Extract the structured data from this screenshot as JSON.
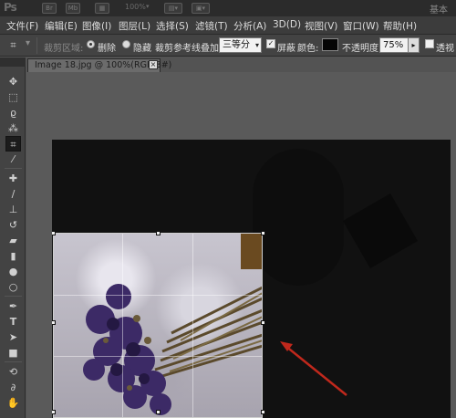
{
  "titlebar": {
    "app_logo": "Ps",
    "zoom": "100%",
    "workspace": "基本"
  },
  "menu": {
    "items": [
      "文件(F)",
      "编辑(E)",
      "图像(I)",
      "图层(L)",
      "选择(S)",
      "滤镜(T)",
      "分析(A)",
      "3D(D)",
      "视图(V)",
      "窗口(W)",
      "帮助(H)"
    ]
  },
  "options": {
    "crop_area_label": "裁剪区域:",
    "delete_label": "删除",
    "hide_label": "隐藏",
    "overlay_label": "裁剪参考线叠加:",
    "overlay_value": "三等分",
    "shield_label": "屏蔽",
    "color_label": "颜色:",
    "color_value": "#050505",
    "opacity_label": "不透明度:",
    "opacity_value": "75%",
    "perspective_label": "透视"
  },
  "document": {
    "tab_title": "Image 18.jpg @ 100%(RGB/8#)",
    "close_glyph": "×"
  },
  "colors": {
    "accent_arrow": "#c0281c",
    "crop_overlay": "#050505"
  },
  "toolbox": {
    "tools": [
      "move-icon",
      "marquee-icon",
      "lasso-icon",
      "quick-select-icon",
      "crop-icon",
      "eyedropper-icon",
      "healing-brush-icon",
      "brush-icon",
      "clone-stamp-icon",
      "history-brush-icon",
      "eraser-icon",
      "gradient-icon",
      "blur-icon",
      "dodge-icon",
      "pen-icon",
      "type-icon",
      "path-select-icon",
      "shape-icon",
      "3d-rotate-icon",
      "3d-camera-icon",
      "hand-icon"
    ]
  }
}
